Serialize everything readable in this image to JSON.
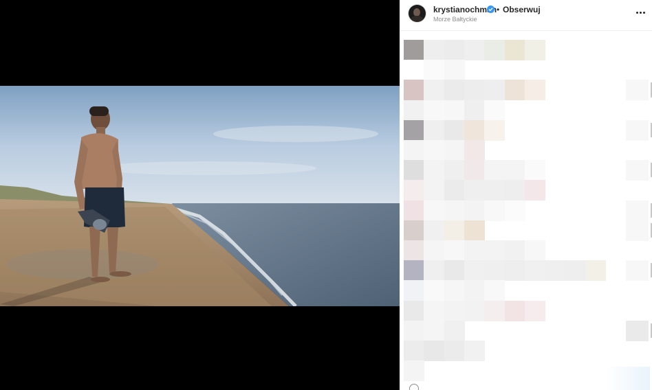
{
  "post": {
    "username": "krystianochman",
    "separator": "•",
    "follow_label": "Obserwuj",
    "location": "Morze Bałtyckie",
    "verified": true,
    "image_description_icon": "beach-photo",
    "comments_state": "pixelated"
  },
  "icons": {
    "verified": "verified-badge-icon",
    "more": "more-options-icon",
    "comment": "comment-icon"
  },
  "colors": {
    "verified_blue": "#3897f0",
    "text_primary": "#262626",
    "text_secondary": "#8e8e8e",
    "media_background": "#000000"
  }
}
